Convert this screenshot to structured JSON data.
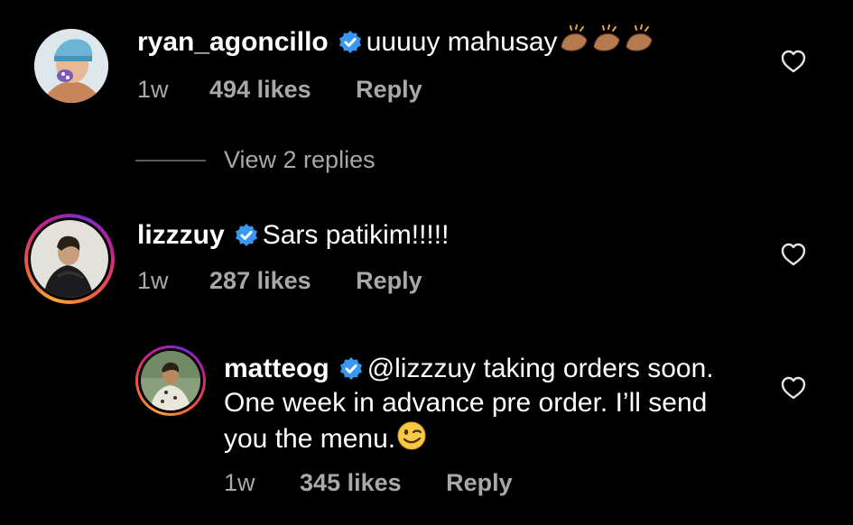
{
  "comments": [
    {
      "username": "ryan_agoncillo",
      "text": "uuuuy mahusay",
      "emoji": "clapping-hands-medium-dark-x3",
      "time": "1w",
      "likes": "494 likes",
      "reply_label": "Reply",
      "view_replies": "View 2 replies"
    },
    {
      "username": "lizzzuy",
      "text": "Sars patikim!!!!!",
      "time": "1w",
      "likes": "287 likes",
      "reply_label": "Reply"
    }
  ],
  "reply": {
    "username": "matteog",
    "text_line1": "@lizzzuy taking orders soon.",
    "text_line2": "One week in advance pre order. I’ll send",
    "text_line3": "you the menu.",
    "emoji": "winking-face",
    "time": "1w",
    "likes": "345 likes",
    "reply_label": "Reply"
  },
  "colors": {
    "background": "#000000",
    "text": "#ffffff",
    "muted": "#a8a8a8",
    "verified": "#3897f0"
  }
}
